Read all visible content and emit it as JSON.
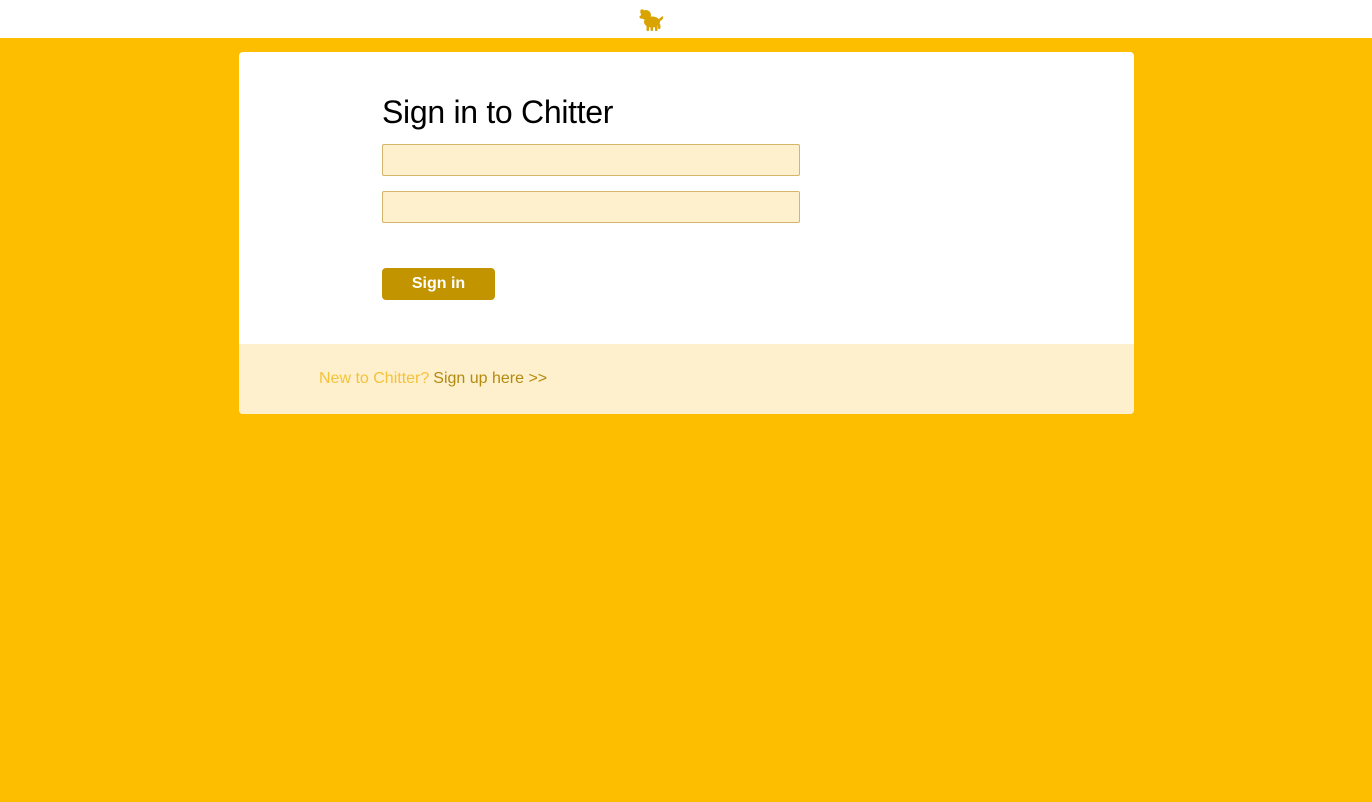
{
  "header": {
    "logo_icon": "dog-logo-icon"
  },
  "signin": {
    "title": "Sign in to Chitter",
    "username_value": "",
    "password_value": "",
    "submit_label": "Sign in"
  },
  "footer": {
    "prompt": "New to Chitter?",
    "link_label": "Sign up here >>"
  },
  "colors": {
    "background": "#FDBE00",
    "card": "#FFFFFF",
    "field_fill": "#FEF0CC",
    "button": "#C29400",
    "footer_band": "#FEF0CC",
    "footer_prompt": "#F4C23A",
    "footer_link": "#B38A0E"
  }
}
